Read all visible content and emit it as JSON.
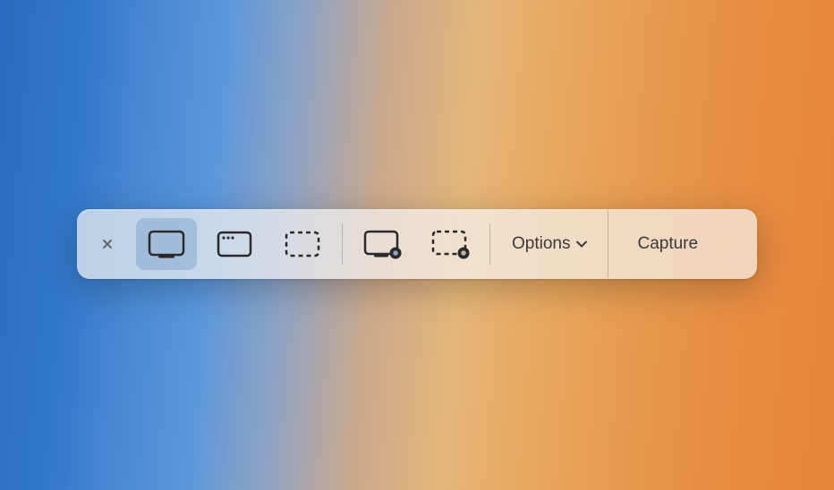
{
  "toolbar": {
    "options_label": "Options",
    "capture_label": "Capture",
    "tools": {
      "capture_entire_screen": "capture-entire-screen",
      "capture_window": "capture-window",
      "capture_selection": "capture-selection",
      "record_entire_screen": "record-entire-screen",
      "record_selection": "record-selection"
    },
    "selected_tool": "capture-entire-screen"
  }
}
